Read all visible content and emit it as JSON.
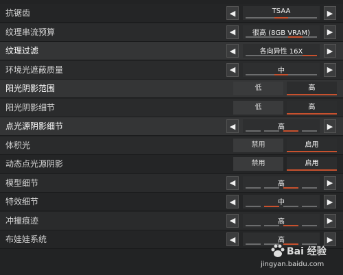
{
  "settings": [
    {
      "id": "antialiasing",
      "label": "抗锯齿",
      "type": "stepper",
      "value": "TSAA",
      "level": 3,
      "levels": 5
    },
    {
      "id": "texture-budget",
      "label": "纹理串流预算",
      "type": "stepper",
      "value": "很高 (8GB VRAM)",
      "level": 4,
      "levels": 5
    },
    {
      "id": "texture-filtering",
      "label": "纹理过滤",
      "type": "stepper",
      "value": "各向异性 16X",
      "level": 5,
      "levels": 5
    },
    {
      "id": "ambient-occlusion",
      "label": "环境光遮蔽质量",
      "type": "stepper",
      "value": "中",
      "level": 3,
      "levels": 5
    },
    {
      "id": "sun-shadow-coverage",
      "label": "阳光阴影范围",
      "type": "toggle",
      "options": [
        "低",
        "高"
      ],
      "selected": 1
    },
    {
      "id": "sun-shadow-detail",
      "label": "阳光阴影细节",
      "type": "toggle",
      "options": [
        "低",
        "高"
      ],
      "selected": 1
    },
    {
      "id": "spot-shadow-detail",
      "label": "点光源阴影细节",
      "type": "stepper",
      "value": "高",
      "level": 3,
      "levels": 4
    },
    {
      "id": "volumetric-lighting",
      "label": "体积光",
      "type": "toggle",
      "options": [
        "禁用",
        "启用"
      ],
      "selected": 1
    },
    {
      "id": "dynamic-spot-shadows",
      "label": "动态点光源阴影",
      "type": "toggle",
      "options": [
        "禁用",
        "启用"
      ],
      "selected": 1
    },
    {
      "id": "model-detail",
      "label": "模型细节",
      "type": "stepper",
      "value": "高",
      "level": 3,
      "levels": 4
    },
    {
      "id": "effects-detail",
      "label": "特效细节",
      "type": "stepper",
      "value": "中",
      "level": 2,
      "levels": 4
    },
    {
      "id": "impact-marks",
      "label": "冲撞痕迹",
      "type": "stepper",
      "value": "高",
      "level": 3,
      "levels": 4
    },
    {
      "id": "ragdolls",
      "label": "布娃娃系统",
      "type": "stepper",
      "value": "高",
      "level": 3,
      "levels": 4
    }
  ],
  "arrows": {
    "left": "◀",
    "right": "▶"
  },
  "watermark": {
    "brand": "Bai 经验",
    "url": "jingyan.baidu.com"
  },
  "colors": {
    "accent": "#c8512e",
    "background": "#222324",
    "row_highlight": "#343536"
  }
}
